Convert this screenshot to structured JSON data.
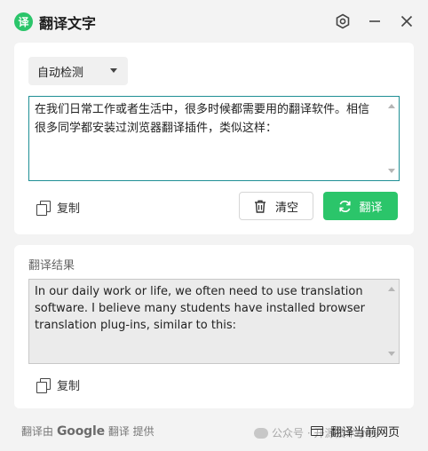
{
  "app": {
    "logo_char": "译",
    "title": "翻译文字"
  },
  "source": {
    "language": "自动检测",
    "text": "在我们日常工作或者生活中，很多时候都需要用的翻译软件。相信很多同学都安装过浏览器翻译插件，类似这样：",
    "copy_label": "复制",
    "clear_label": "清空",
    "translate_label": "翻译"
  },
  "result": {
    "section_label": "翻译结果",
    "text": "In our daily work or life, we often need to use translation software. I believe many students have installed browser translation plug-ins, similar to this:",
    "copy_label": "复制"
  },
  "footer": {
    "powered_prefix": "翻译由",
    "google": "Google",
    "powered_suffix": "翻译 提供",
    "translate_page_label": "翻译当前网页",
    "watermark": "公众号 · 开源技术小栈"
  },
  "colors": {
    "accent": "#2bc56a",
    "focus_border": "#1f8f95"
  }
}
